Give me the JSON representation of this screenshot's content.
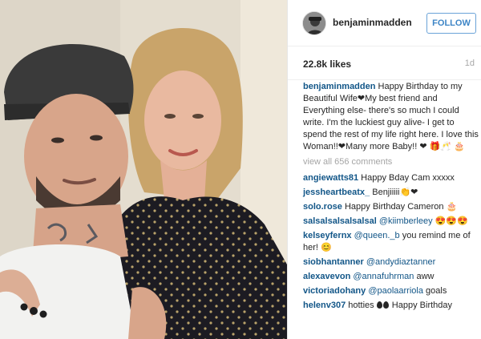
{
  "post": {
    "username": "benjaminmadden",
    "follow_label": "FOLLOW",
    "likes": "22.8k likes",
    "age": "1d",
    "caption": {
      "username": "benjaminmadden",
      "text": "Happy Birthday to my Beautiful Wife❤My best friend and Everything else- there's so much I could write. I'm the luckiest guy alive- I get to spend the rest of my life right here. I love this Woman!!❤Many more Baby!! ❤ 🎁🥂 🎂"
    },
    "view_all": "view all 656 comments",
    "comments": [
      {
        "username": "angiewatts81",
        "text": "Happy Bday Cam xxxxx"
      },
      {
        "username": "jessheartbeatx_",
        "text": "Benjiiiii👏❤"
      },
      {
        "username": "solo.rose",
        "text": "Happy Birthday Cameron 🎂"
      },
      {
        "username": "salsalsalsalsalsal",
        "mention": "@kiimberleey",
        "text": " 😍😍😍"
      },
      {
        "username": "kelseyfernx",
        "mention": "@queen._b",
        "text": " you remind me of her! 😊"
      },
      {
        "username": "siobhantanner",
        "mention": "@andydiaztanner",
        "text": ""
      },
      {
        "username": "alexavevon",
        "mention": "@annafuhrman",
        "text": " aww"
      },
      {
        "username": "victoriadohany",
        "mention": "@paolaarriola",
        "text": " goals"
      },
      {
        "username": "helenv307",
        "text": " hotties",
        "drops": 2,
        "text_after": " Happy Birthday"
      }
    ]
  },
  "colors": {
    "username_blue": "#125688",
    "follow_blue": "#3d85c6",
    "muted_gray": "#a8a8a8"
  },
  "icons": {
    "avatar": "profile-photo",
    "heart": "heart-icon"
  }
}
